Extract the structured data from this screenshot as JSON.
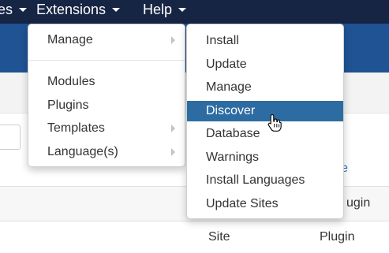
{
  "navbar": {
    "items": [
      {
        "label": "es"
      },
      {
        "label": "Extensions"
      },
      {
        "label": "Help"
      }
    ]
  },
  "extensions_menu": {
    "items": [
      {
        "label": "Manage",
        "submenu": true
      },
      {
        "label": "Modules",
        "submenu": false
      },
      {
        "label": "Plugins",
        "submenu": false
      },
      {
        "label": "Templates",
        "submenu": true
      },
      {
        "label": "Language(s)",
        "submenu": true
      }
    ]
  },
  "manage_submenu": {
    "items": [
      {
        "label": "Install"
      },
      {
        "label": "Update"
      },
      {
        "label": "Manage"
      },
      {
        "label": "Discover",
        "active": true
      },
      {
        "label": "Database"
      },
      {
        "label": "Warnings"
      },
      {
        "label": "Install Languages"
      },
      {
        "label": "Update Sites"
      }
    ]
  },
  "page": {
    "link_fragment": "e",
    "table": {
      "header_tail": "ugin",
      "row": {
        "site": "Site",
        "type": "Plugin"
      }
    }
  },
  "colors": {
    "navbar_bg": "#172545",
    "subheader_bg": "#1f5394",
    "active_item_bg": "#2d6ca2",
    "link": "#2e70b8"
  },
  "icons": {
    "cursor": "hand-pointer-icon",
    "submenu_arrow": "caret-right-icon",
    "nav_caret": "caret-down-icon"
  }
}
